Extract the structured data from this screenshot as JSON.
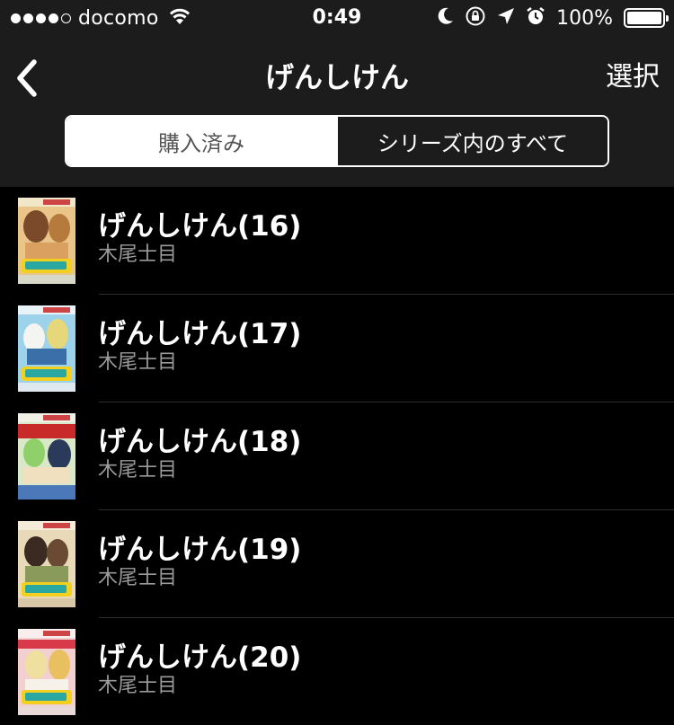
{
  "status_bar": {
    "carrier": "docomo",
    "time": "0:49",
    "battery": "100%",
    "signal_dots_filled": 4,
    "signal_dots_total": 5
  },
  "nav": {
    "title": "げんしけん",
    "select_label": "選択",
    "back_icon": "chevron-left-icon"
  },
  "segments": [
    {
      "label": "購入済み",
      "active": true
    },
    {
      "label": "シリーズ内のすべて",
      "active": false
    }
  ],
  "books": [
    {
      "title": "げんしけん(16)",
      "author": "木尾士目"
    },
    {
      "title": "げんしけん(17)",
      "author": "木尾士目"
    },
    {
      "title": "げんしけん(18)",
      "author": "木尾士目"
    },
    {
      "title": "げんしけん(19)",
      "author": "木尾士目"
    },
    {
      "title": "げんしけん(20)",
      "author": "木尾士目"
    }
  ],
  "colors": {
    "background": "#000000",
    "bar_background": "#1c1c1c",
    "text": "#ffffff",
    "subtext": "#9a9a9a",
    "separator": "#2e2e2e"
  }
}
